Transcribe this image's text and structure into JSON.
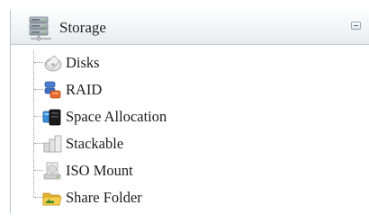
{
  "panel": {
    "title": "Storage",
    "title_icon": "storage-server-icon",
    "collapse_icon": "collapse-minus-icon"
  },
  "tree": {
    "items": [
      {
        "label": "Disks",
        "icon": "disks-icon"
      },
      {
        "label": "RAID",
        "icon": "raid-icon"
      },
      {
        "label": "Space Allocation",
        "icon": "space-allocation-icon"
      },
      {
        "label": "Stackable",
        "icon": "stackable-icon"
      },
      {
        "label": "ISO Mount",
        "icon": "iso-mount-icon"
      },
      {
        "label": "Share Folder",
        "icon": "share-folder-icon"
      }
    ]
  },
  "colors": {
    "header_gradient_top": "#fdfefe",
    "header_gradient_bottom": "#e6ebee",
    "panel_border": "#b9c3cc",
    "tree_line": "#9a9a9a",
    "text": "#1c1c1c"
  }
}
